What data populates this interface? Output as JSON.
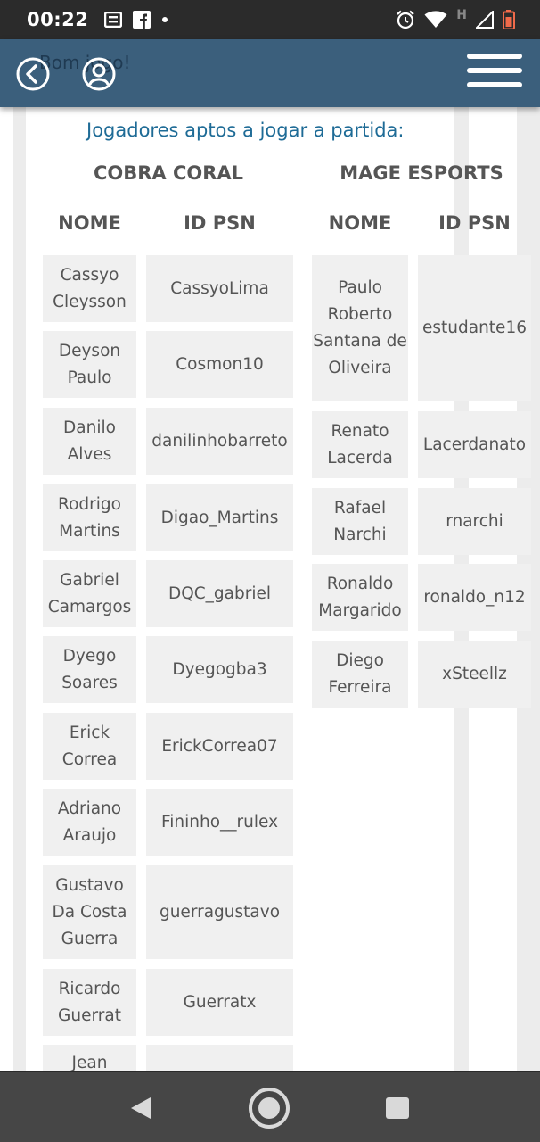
{
  "status_bar": {
    "time": "00:22",
    "icons": [
      "notes-icon",
      "facebook-icon",
      "dot-icon",
      "alarm-icon",
      "wifi-icon",
      "h-network-icon",
      "signal-icon",
      "battery-icon"
    ],
    "network_label": "H"
  },
  "header": {
    "greeting": "Bom jogo!",
    "back_icon": "back-arrow-icon",
    "user_icon": "user-icon",
    "menu_icon": "hamburger-menu-icon",
    "color": "#3b5f7c"
  },
  "section_title": "Jogadores aptos a jogar a partida:",
  "teams": [
    {
      "name": "COBRA CORAL",
      "col_name": "NOME",
      "col_id": "ID PSN",
      "players": [
        {
          "name": "Cassyo Cleysson",
          "psn": "CassyoLima"
        },
        {
          "name": "Deyson Paulo",
          "psn": "Cosmon10"
        },
        {
          "name": "Danilo Alves",
          "psn": "danilinhobarreto"
        },
        {
          "name": "Rodrigo Martins",
          "psn": "Digao_Martins"
        },
        {
          "name": "Gabriel Camargos",
          "psn": "DQC_gabriel"
        },
        {
          "name": "Dyego Soares",
          "psn": "Dyegogba3"
        },
        {
          "name": "Erick Correa",
          "psn": "ErickCorrea07"
        },
        {
          "name": "Adriano Araujo",
          "psn": "Fininho__rulex"
        },
        {
          "name": "Gustavo Da Costa Guerra",
          "psn": "guerragustavo"
        },
        {
          "name": "Ricardo Guerrat",
          "psn": "Guerratx"
        },
        {
          "name": "Jean",
          "psn": ""
        }
      ]
    },
    {
      "name": "MAGE ESPORTS",
      "col_name": "NOME",
      "col_id": "ID PSN",
      "players": [
        {
          "name": "Paulo Roberto Santana de Oliveira",
          "psn": "estudante16"
        },
        {
          "name": "Renato Lacerda",
          "psn": "Lacerdanato"
        },
        {
          "name": "Rafael Narchi",
          "psn": "rnarchi"
        },
        {
          "name": "Ronaldo Margarido",
          "psn": "ronaldo_n12"
        },
        {
          "name": "Diego Ferreira",
          "psn": "xSteellz"
        }
      ]
    }
  ],
  "nav_bar": {
    "icons": [
      "nav-back-icon",
      "nav-home-icon",
      "nav-recents-icon"
    ]
  }
}
